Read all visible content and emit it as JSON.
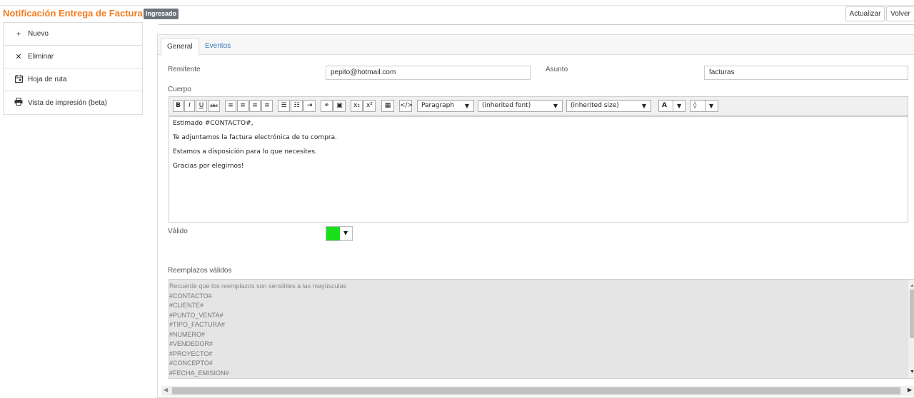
{
  "header": {
    "title": "Notificación Entrega de Factura",
    "status_badge": "Ingresado",
    "actualizar_label": "Actualizar",
    "volver_label": "Volver"
  },
  "sidebar": {
    "items": [
      {
        "label": "Nuevo",
        "icon": "plus-icon"
      },
      {
        "label": "Eliminar",
        "icon": "close-icon"
      },
      {
        "label": "Hoja de ruta",
        "icon": "calendar-icon"
      },
      {
        "label": "Vista de impresión (beta)",
        "icon": "print-icon"
      }
    ]
  },
  "tabs": [
    {
      "label": "General",
      "active": true
    },
    {
      "label": "Eventos",
      "active": false
    }
  ],
  "form": {
    "remitente_label": "Remitente",
    "remitente_value": "pepito@hotmail.com",
    "asunto_label": "Asunto",
    "asunto_value": "facturas",
    "cuerpo_label": "Cuerpo",
    "valido_label": "Válido",
    "valido_color": "#1adf1a",
    "reemplazos_label": "Reemplazos válidos"
  },
  "editor": {
    "toolbar": {
      "bold": "B",
      "italic": "I",
      "underline": "U",
      "strike": "abc",
      "sub": "x₂",
      "sup": "x²",
      "paragraph_select": "Paragraph",
      "font_select": "(inherited font)",
      "size_select": "(inherited size)",
      "font_color": "A"
    },
    "body_lines": [
      "Estimado #CONTACTO#,",
      "Te adjuntamos la factura electrónica de tu compra.",
      "Estamos a disposición para lo que necesites.",
      "Gracias por elegirnos!"
    ]
  },
  "reemplazos": [
    "Recuerde que los reemplazos son sensibles a las mayúsculas",
    "#CONTACTO#",
    "#CLIENTE#",
    "#PUNTO_VENTA#",
    "#TIPO_FACTURA#",
    "#NUMERO#",
    "#VENDEDOR#",
    "#PROYECTO#",
    "#CONCEPTO#",
    "#FECHA_EMISION#"
  ],
  "colors": {
    "brand": "#f47c20",
    "badge": "#6c757d",
    "link": "#337ab7"
  }
}
